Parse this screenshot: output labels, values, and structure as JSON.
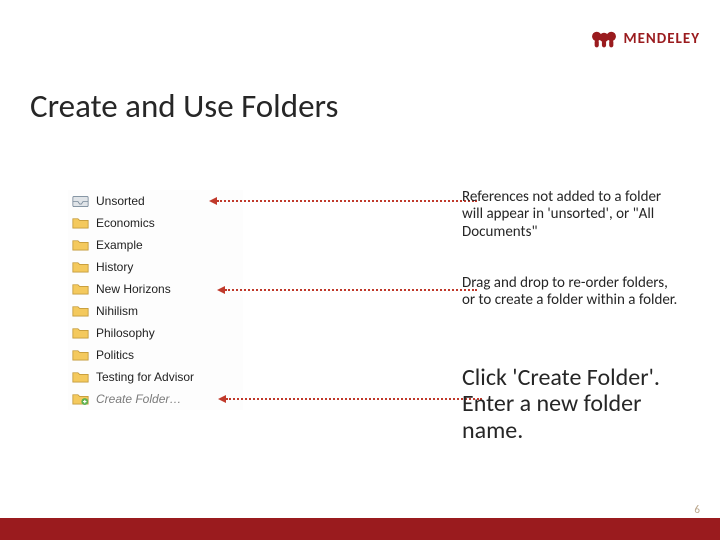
{
  "brand": {
    "name": "MENDELEY",
    "color": "#9a1b1e"
  },
  "title": "Create and Use Folders",
  "folders": {
    "items": [
      {
        "label": "Unsorted",
        "icon": "inbox"
      },
      {
        "label": "Economics",
        "icon": "folder"
      },
      {
        "label": "Example",
        "icon": "folder"
      },
      {
        "label": "History",
        "icon": "folder"
      },
      {
        "label": "New Horizons",
        "icon": "folder"
      },
      {
        "label": "Nihilism",
        "icon": "folder"
      },
      {
        "label": "Philosophy",
        "icon": "folder"
      },
      {
        "label": "Politics",
        "icon": "folder"
      },
      {
        "label": "Testing for Advisor",
        "icon": "folder"
      },
      {
        "label": "Create Folder…",
        "icon": "folder-create"
      }
    ]
  },
  "annotations": {
    "unsorted": "References not added to a folder\nwill appear in 'unsorted', or \"All Documents\"",
    "reorder": "Drag and drop to re-order folders, or to create a folder within a folder.",
    "create": "Click 'Create Folder'. Enter a new folder name."
  },
  "pagenum": "6"
}
